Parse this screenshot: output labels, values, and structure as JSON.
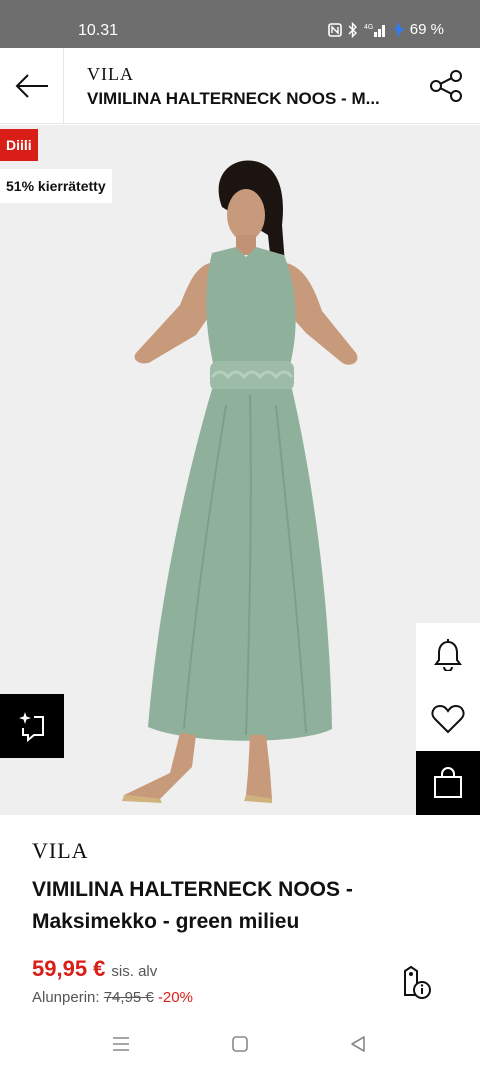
{
  "status_bar": {
    "time": "10.31",
    "battery": "69 %",
    "network": "4G"
  },
  "header": {
    "brand": "VILA",
    "title": "VIMILINA HALTERNECK NOOS - M..."
  },
  "badges": {
    "deal": "Diili",
    "recycled": "51% kierrätetty"
  },
  "product": {
    "brand": "VILA",
    "name": "VIMILINA HALTERNECK NOOS - Maksimekko - green milieu",
    "price": "59,95 €",
    "price_note": "sis. alv",
    "original_label": "Alunperin:",
    "original_price": "74,95 €",
    "discount": "-20%",
    "dress_color": "#8fb09b"
  },
  "gallery": {
    "current_image": 1
  },
  "icons": {
    "back": "arrow-left-icon",
    "share": "share-icon",
    "notify": "bell-icon",
    "wishlist": "heart-icon",
    "cart": "shopping-bag-icon",
    "ai": "sparkle-frame-icon",
    "info": "price-tag-info-icon"
  },
  "colors": {
    "accent_red": "#d91e18",
    "status_bar": "#6e6e6e",
    "image_bg": "#efefef"
  }
}
